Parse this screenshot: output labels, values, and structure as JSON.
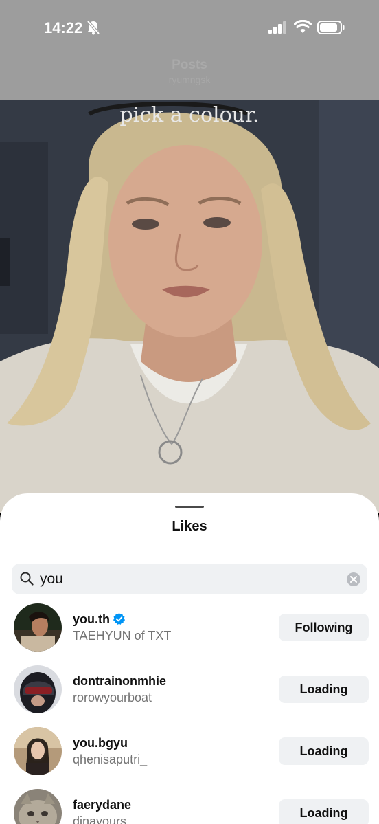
{
  "status_bar": {
    "time": "14:22"
  },
  "header": {
    "title": "Posts",
    "subtitle": "ryumngsk"
  },
  "video": {
    "caption": "pick a colour."
  },
  "sheet": {
    "title": "Likes",
    "search": {
      "value": "you"
    },
    "users": [
      {
        "username": "you.th",
        "verified": true,
        "full_name": "TAEHYUN of TXT",
        "button": "Following"
      },
      {
        "username": "dontrainonmhie",
        "verified": false,
        "full_name": "rorowyourboat",
        "button": "Loading"
      },
      {
        "username": "you.bgyu",
        "verified": false,
        "full_name": "qhenisaputri_",
        "button": "Loading"
      },
      {
        "username": "faerydane",
        "verified": false,
        "full_name": "dinayours",
        "button": "Loading"
      }
    ]
  },
  "colors": {
    "verified": "#0095f6",
    "sheet_bg": "#ffffff",
    "button_bg": "#eff1f3"
  }
}
